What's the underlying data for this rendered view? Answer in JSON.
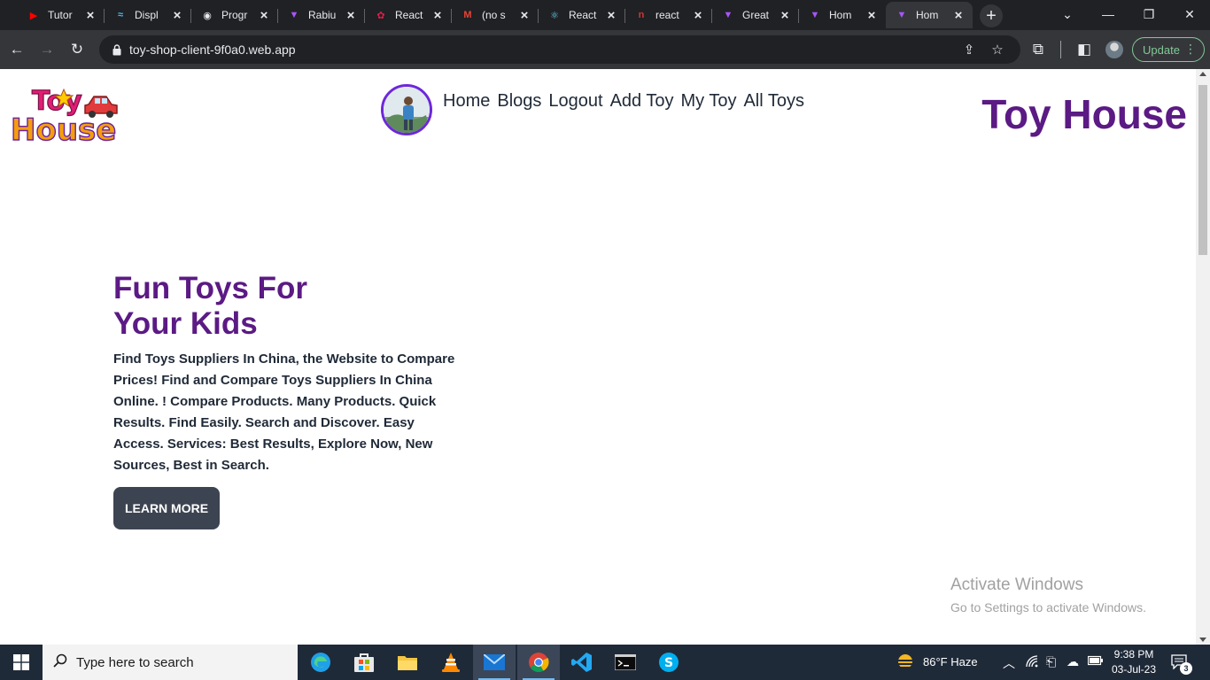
{
  "browser": {
    "tabs": [
      {
        "title": "Tutor",
        "icon": "youtube-studio-icon",
        "color": "#ff0000"
      },
      {
        "title": "Displ",
        "icon": "tailwind-icon",
        "color": "#38bdf8"
      },
      {
        "title": "Progr",
        "icon": "location-pin-icon",
        "color": "#e8eaed"
      },
      {
        "title": "Rabiu",
        "icon": "vite-icon",
        "color": "#a855f7"
      },
      {
        "title": "React",
        "icon": "react-redux-icon",
        "color": "#e11d48"
      },
      {
        "title": "(no s",
        "icon": "gmail-icon",
        "color": "#ea4335"
      },
      {
        "title": "React",
        "icon": "react-icon",
        "color": "#61dafb"
      },
      {
        "title": "react",
        "icon": "npm-icon",
        "color": "#cb3837"
      },
      {
        "title": "Great",
        "icon": "vite-icon",
        "color": "#a855f7"
      },
      {
        "title": "Hom",
        "icon": "vite-icon",
        "color": "#a855f7"
      },
      {
        "title": "Hom",
        "icon": "vite-icon",
        "color": "#a855f7",
        "active": true
      }
    ],
    "url": "toy-shop-client-9f0a0.web.app",
    "update_label": "Update"
  },
  "page": {
    "logo_text": [
      "Toy",
      "House"
    ],
    "nav_links": [
      "Home",
      "Blogs",
      "Logout",
      "Add Toy",
      "My Toy",
      "All Toys"
    ],
    "brand": "Toy House",
    "hero": {
      "title_line1": "Fun Toys For",
      "title_line2": "Your Kids",
      "description": "Find Toys Suppliers In China, the Website to Compare Prices! Find and Compare Toys Suppliers In China Online. ! Compare Products. Many Products. Quick Results. Find Easily. Search and Discover. Easy Access. Services: Best Results, Explore Now, New Sources, Best in Search.",
      "button": "LEARN MORE"
    },
    "brand_color": "#5b1a84"
  },
  "watermark": {
    "line1": "Activate Windows",
    "line2": "Go to Settings to activate Windows."
  },
  "taskbar": {
    "search_placeholder": "Type here to search",
    "weather": "86°F  Haze",
    "time": "9:38 PM",
    "date": "03-Jul-23",
    "notification_count": "3"
  }
}
